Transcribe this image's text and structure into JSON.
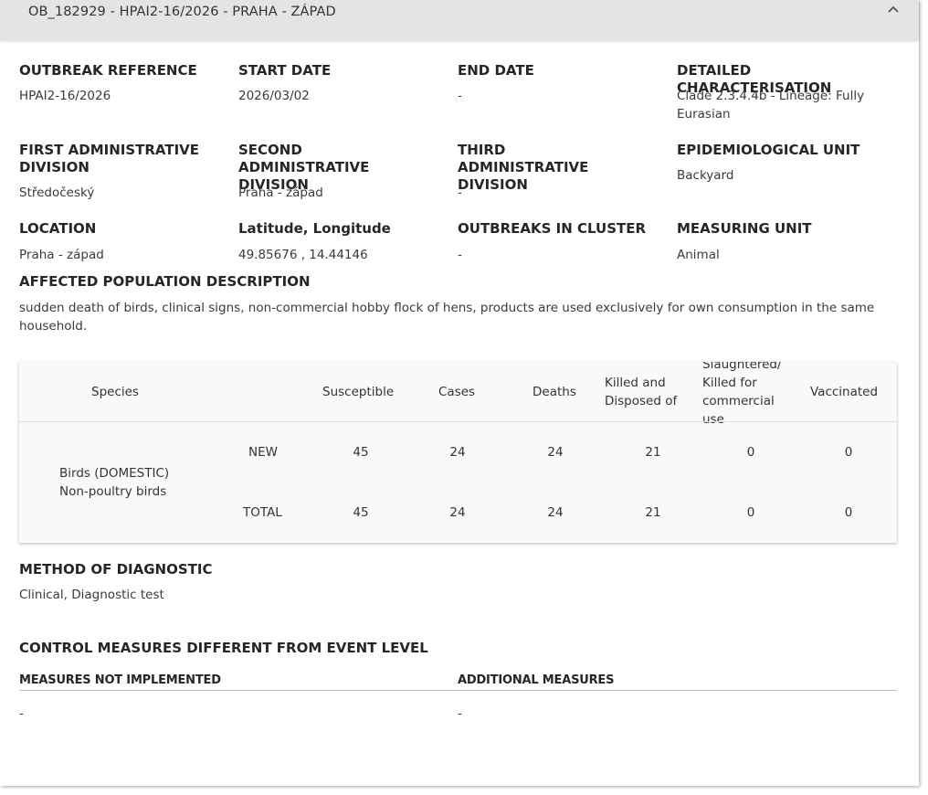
{
  "panel": {
    "title": "OB_182929 - HPAI2-16/2026 - PRAHA - ZÁPAD",
    "collapse_icon": "chevron-up-icon"
  },
  "fields": {
    "outbreak_reference": {
      "label": "OUTBREAK REFERENCE",
      "value": "HPAI2-16/2026"
    },
    "start_date": {
      "label": "START DATE",
      "value": "2026/03/02"
    },
    "end_date": {
      "label": "END DATE",
      "value": "-"
    },
    "detailed_characterisation": {
      "label": "DETAILED CHARACTERISATION",
      "value": "Clade 2.3.4.4b - Lineage: Fully Eurasian"
    },
    "first_admin_division": {
      "label": "FIRST ADMINISTRATIVE DIVISION",
      "value": "Středočeský"
    },
    "second_admin_division": {
      "label": "SECOND ADMINISTRATIVE DIVISION",
      "value": "Praha - západ"
    },
    "third_admin_division": {
      "label": "THIRD ADMINISTRATIVE DIVISION",
      "value": "-"
    },
    "epidemiological_unit": {
      "label": "EPIDEMIOLOGICAL UNIT",
      "value": "Backyard"
    },
    "location": {
      "label": "LOCATION",
      "value": "Praha - západ"
    },
    "lat_long": {
      "label": "Latitude, Longitude",
      "value": "49.85676 , 14.44146"
    },
    "outbreaks_in_cluster": {
      "label": "OUTBREAKS IN CLUSTER",
      "value": "-"
    },
    "measuring_unit": {
      "label": "MEASURING UNIT",
      "value": "Animal"
    }
  },
  "affected_population": {
    "label": "AFFECTED POPULATION DESCRIPTION",
    "text": "sudden death of birds, clinical signs, non-commercial hobby flock of hens, products are used exclusively for own consumption in the same household."
  },
  "table": {
    "headers": {
      "species": "Species",
      "susceptible": "Susceptible",
      "cases": "Cases",
      "deaths": "Deaths",
      "killed": "Killed and Disposed of",
      "slaughtered": "Slaughtered/ Killed for commercial use",
      "vaccinated": "Vaccinated"
    },
    "species_name": "Birds (DOMESTIC) Non-poultry birds",
    "rows": [
      {
        "type": "NEW",
        "susceptible": "45",
        "cases": "24",
        "deaths": "24",
        "killed": "21",
        "slaughtered": "0",
        "vaccinated": "0"
      },
      {
        "type": "TOTAL",
        "susceptible": "45",
        "cases": "24",
        "deaths": "24",
        "killed": "21",
        "slaughtered": "0",
        "vaccinated": "0"
      }
    ]
  },
  "method_of_diagnostic": {
    "label": "METHOD OF DIAGNOSTIC",
    "value": "Clinical, Diagnostic test"
  },
  "control_measures": {
    "title": "CONTROL MEASURES DIFFERENT FROM EVENT LEVEL",
    "not_implemented_label": "MEASURES NOT IMPLEMENTED",
    "not_implemented_value": "-",
    "additional_label": "ADDITIONAL MEASURES",
    "additional_value": "-"
  }
}
